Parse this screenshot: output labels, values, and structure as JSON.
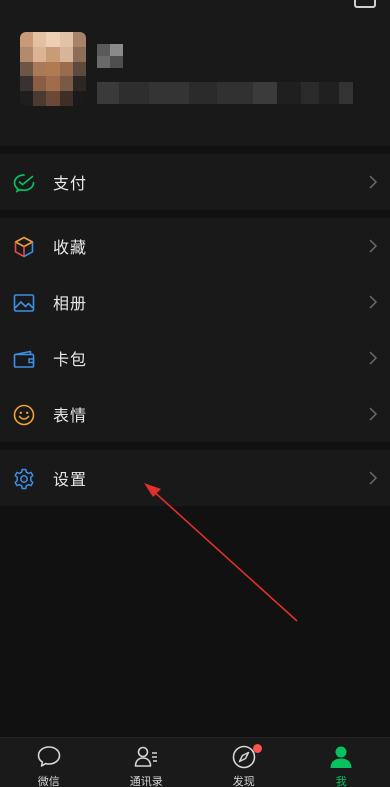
{
  "menu": {
    "pay_label": "支付",
    "favorites_label": "收藏",
    "album_label": "相册",
    "cards_label": "卡包",
    "stickers_label": "表情",
    "settings_label": "设置"
  },
  "tabbar": {
    "chats_label": "微信",
    "contacts_label": "通讯录",
    "discover_label": "发现",
    "me_label": "我",
    "active_tab": "我"
  },
  "colors": {
    "accent": "#07c160",
    "badge": "#fa5151",
    "icon_blue": "#3d8ee8",
    "icon_orange": "#f0a23a",
    "background": "#111111",
    "cell": "#191919",
    "arrow": "#e0302a"
  },
  "icons": {
    "pay": "wechat-pay-icon",
    "favorites": "cube-icon",
    "album": "picture-icon",
    "cards": "wallet-icon",
    "stickers": "smiley-icon",
    "settings": "gear-icon",
    "chats": "chat-bubble-icon",
    "contacts": "contacts-icon",
    "discover": "compass-icon",
    "me": "person-icon"
  }
}
